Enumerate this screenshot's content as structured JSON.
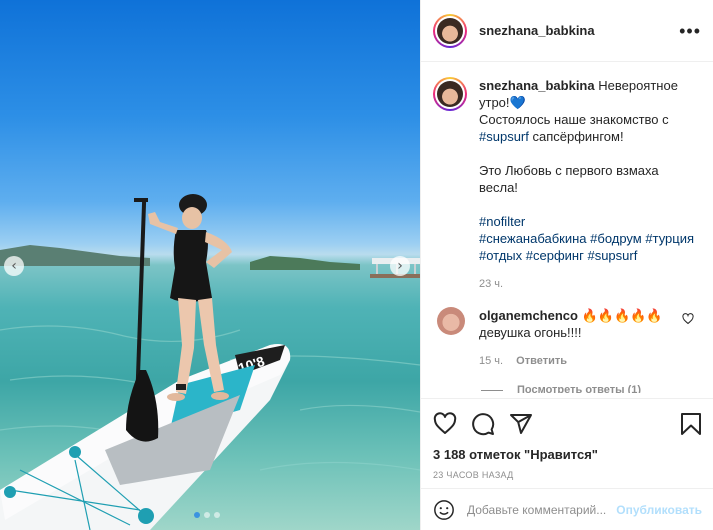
{
  "post": {
    "username": "snezhana_babkina",
    "more_label": "•••"
  },
  "caption": {
    "username": "snezhana_babkina",
    "line1": "Невероятное утро!",
    "heart": "💙",
    "line2": "Состоялось наше знакомство с ",
    "tag_supsurf": "#supsurf",
    "line2_end": " сапсёрфингом!",
    "line3": "Это Любовь с первого взмаха весла!",
    "tag_nofilter": "#nofilter",
    "tags_row1": [
      "#снежанабабкина",
      "#бодрум",
      "#турция"
    ],
    "tags_row2": [
      "#отдых",
      "#серфинг",
      "#supsurf"
    ],
    "time": "23 ч."
  },
  "comment": {
    "username": "olganemchenco",
    "emoji": "🔥🔥🔥🔥🔥",
    "text": "девушка огонь!!!!",
    "time": "15 ч.",
    "reply_label": "Ответить",
    "view_replies": "Посмотреть ответы (1)",
    "like_icon": "heart-outline-icon"
  },
  "actions": {
    "likes_text": "3 188 отметок \"Нравится\"",
    "posted_time": "23 ЧАСОВ НАЗАД"
  },
  "add_comment": {
    "placeholder": "Добавьте комментарий...",
    "publish_label": "Опубликовать"
  },
  "photo": {
    "prev_icon": "‹",
    "next_icon": "›",
    "board_text": "10'8",
    "carousel_count": 3,
    "carousel_active": 1
  },
  "colors": {
    "accent": "#0095f6",
    "publish_disabled": "#b2dffc",
    "hashtag": "#00376b",
    "muted": "#8e8e8e"
  }
}
